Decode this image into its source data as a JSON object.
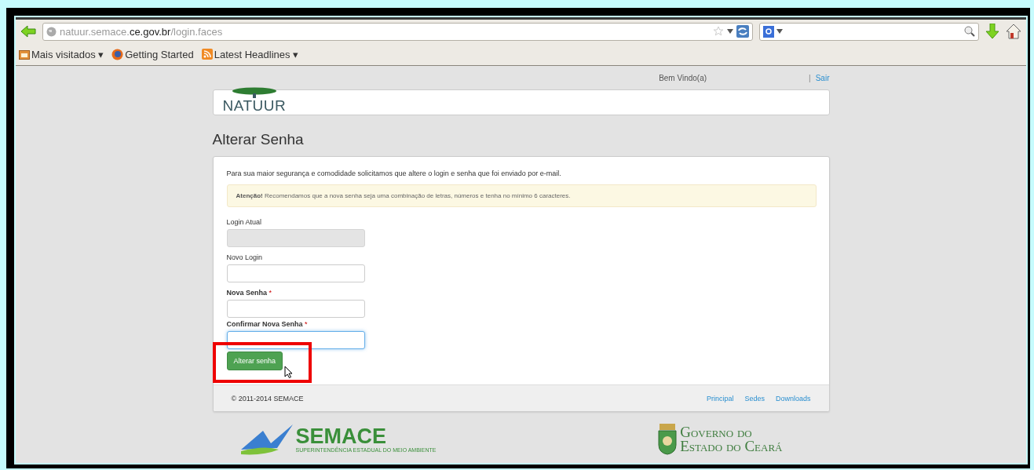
{
  "browser": {
    "url_parts": [
      {
        "text": "natuur.semace.",
        "emphasis": false
      },
      {
        "text": "ce.gov.br",
        "emphasis": true
      },
      {
        "text": "/login.faces",
        "emphasis": false
      }
    ],
    "bookmarks": [
      {
        "kind": "folder",
        "label": "Mais visitados ▾"
      },
      {
        "kind": "firefox",
        "label": "Getting Started"
      },
      {
        "kind": "rss",
        "label": "Latest Headlines ▾"
      }
    ]
  },
  "header": {
    "welcome": "Bem Vindo(a)",
    "separator": "|",
    "logout": "Sair"
  },
  "logo": {
    "text": "NATUUR"
  },
  "page_title": "Alterar Senha",
  "form": {
    "intro": "Para sua maior segurança e comodidade solicitamos que altere o login e senha que foi enviado por e-mail.",
    "alert": "**Atenção!** Recomendamos que a nova senha seja uma combinação de letras, números e tenha no mínimo 6 caracteres.",
    "fields": [
      {
        "label": "Login Atual",
        "required": false,
        "disabled": true,
        "focused": false
      },
      {
        "label": "Novo Login",
        "required": false,
        "disabled": false,
        "focused": false
      },
      {
        "label": "Nova Senha",
        "required": true,
        "required_mark": "*",
        "disabled": false,
        "focused": false
      },
      {
        "label": "Confirmar Nova Senha",
        "required": true,
        "required_mark": "*",
        "disabled": false,
        "focused": true
      }
    ],
    "submit": "Alterar senha"
  },
  "footer": {
    "copyright": "© 2011-2014 SEMACE",
    "links": [
      "Principal",
      "Sedes",
      "Downloads"
    ]
  },
  "partners": {
    "semace": {
      "name": "SEMACE",
      "subtitle": "SUPERINTENDÊNCIA ESTADUAL DO MEIO AMBIENTE"
    },
    "governo": {
      "line_1": "Governo do",
      "line_2": "Estado do Ceará"
    }
  }
}
